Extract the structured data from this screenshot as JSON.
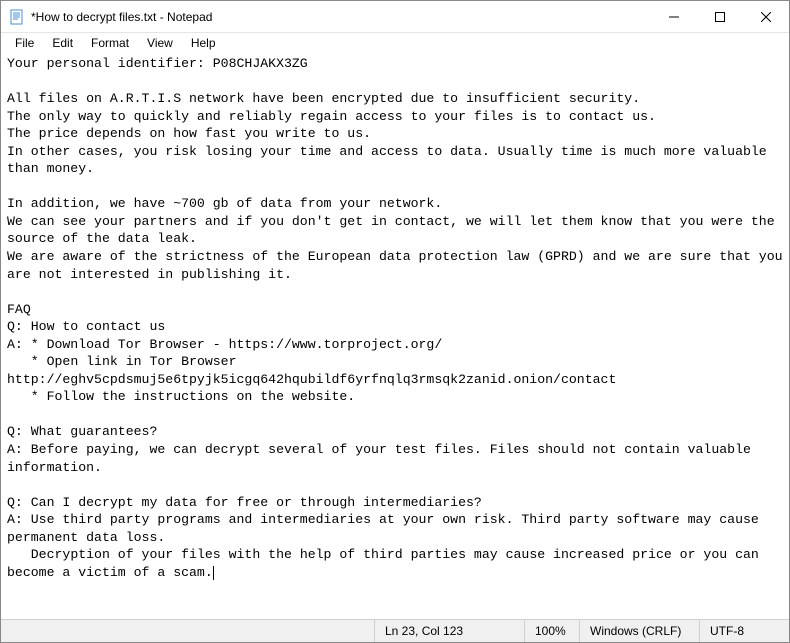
{
  "window": {
    "title": "*How to decrypt files.txt - Notepad"
  },
  "menu": {
    "file": "File",
    "edit": "Edit",
    "format": "Format",
    "view": "View",
    "help": "Help"
  },
  "content": {
    "text": "Your personal identifier: P08CHJAKX3ZG\n\nAll files on A.R.T.I.S network have been encrypted due to insufficient security.\nThe only way to quickly and reliably regain access to your files is to contact us.\nThe price depends on how fast you write to us.\nIn other cases, you risk losing your time and access to data. Usually time is much more valuable than money.\n\nIn addition, we have ~700 gb of data from your network.\nWe can see your partners and if you don't get in contact, we will let them know that you were the source of the data leak.\nWe are aware of the strictness of the European data protection law (GPRD) and we are sure that you are not interested in publishing it.\n\nFAQ\nQ: How to contact us\nA: * Download Tor Browser - https://www.torproject.org/\n   * Open link in Tor Browser\nhttp://eghv5cpdsmuj5e6tpyjk5icgq642hqubildf6yrfnqlq3rmsqk2zanid.onion/contact\n   * Follow the instructions on the website.\n\nQ: What guarantees?\nA: Before paying, we can decrypt several of your test files. Files should not contain valuable information.\n\nQ: Can I decrypt my data for free or through intermediaries?\nA: Use third party programs and intermediaries at your own risk. Third party software may cause permanent data loss.\n   Decryption of your files with the help of third parties may cause increased price or you can become a victim of a scam."
  },
  "statusbar": {
    "position": "Ln 23, Col 123",
    "zoom": "100%",
    "lineending": "Windows (CRLF)",
    "encoding": "UTF-8"
  }
}
